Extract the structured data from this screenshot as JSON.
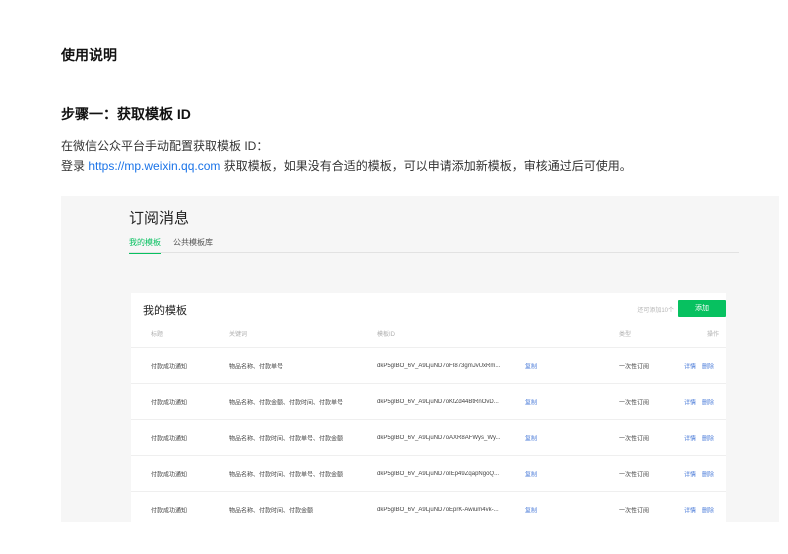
{
  "doc": {
    "heading": "使用说明",
    "step_heading": "步骤一：获取模板 ID",
    "line1": "在微信公众平台手动配置获取模板 ID：",
    "line2_prefix": "登录 ",
    "line2_link": "https://mp.weixin.qq.com",
    "line2_suffix": " 获取模板，如果没有合适的模板，可以申请添加新模板，审核通过后可使用。"
  },
  "screenshot": {
    "title": "订阅消息",
    "tabs": [
      "我的模板",
      "公共模板库"
    ],
    "active_tab": 0,
    "card_title": "我的模板",
    "limit_text": "还可添加10个",
    "add_label": "添加",
    "columns": {
      "title": "标题",
      "keywords": "关键词",
      "template_id": "模板ID",
      "type": "类型",
      "ops": "操作"
    },
    "rows": [
      {
        "title": "付款成功通知",
        "keywords": "物品名称、付款单号",
        "template_id": "dkP5gIBO_6V_A9LjuND7oFI873gmJvUxRm...",
        "copy": "复制",
        "type": "一次性订阅",
        "detail": "详情",
        "delete": "删除"
      },
      {
        "title": "付款成功通知",
        "keywords": "物品名称、付款金额、付款时间、付款单号",
        "template_id": "dkP5gIBO_6V_A9LjuND7oKtZd44BtRnOvD...",
        "copy": "复制",
        "type": "一次性订阅",
        "detail": "详情",
        "delete": "删除"
      },
      {
        "title": "付款成功通知",
        "keywords": "物品名称、付款时间、付款单号、付款金额",
        "template_id": "dkP5gIBO_6V_A9LjuND7oAXR8AFWys_Wy...",
        "copy": "复制",
        "type": "一次性订阅",
        "detail": "详情",
        "delete": "删除"
      },
      {
        "title": "付款成功通知",
        "keywords": "物品名称、付款时间、付款单号、付款金额",
        "template_id": "dkP5gIBO_6V_A9LjuND7oIEp49ZqapNgoQ...",
        "copy": "复制",
        "type": "一次性订阅",
        "detail": "详情",
        "delete": "删除"
      },
      {
        "title": "付款成功通知",
        "keywords": "物品名称、付款时间、付款金额",
        "template_id": "dkP5gIBO_6V_A9LjuND7oEprK-Awium4vk-...",
        "copy": "复制",
        "type": "一次性订阅",
        "detail": "详情",
        "delete": "删除"
      }
    ],
    "colors": {
      "accent": "#07c160",
      "link": "#4a7bd9"
    }
  }
}
